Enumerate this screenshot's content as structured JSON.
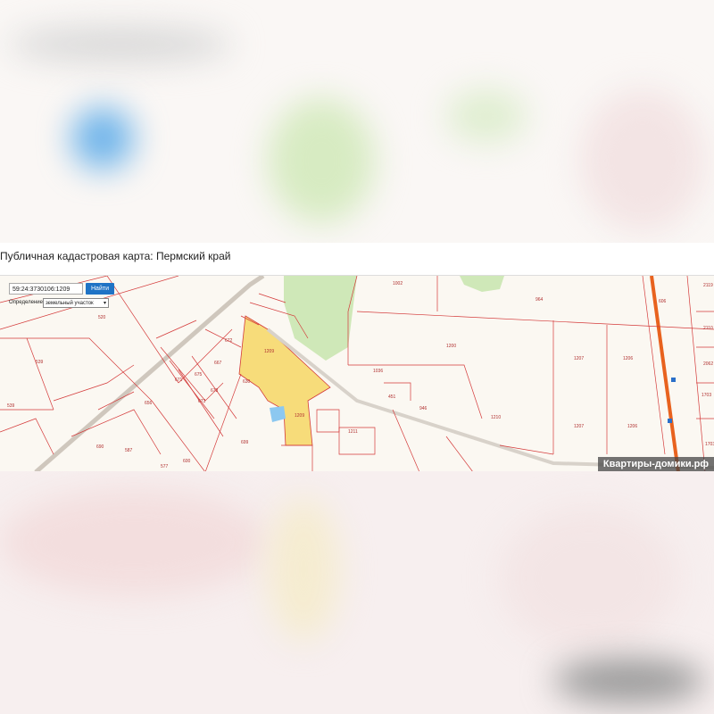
{
  "page_title": "Публичная кадастровая карта: Пермский край",
  "search": {
    "value": "59:24:3730106:1209",
    "button_label": "Найти"
  },
  "definition": {
    "label": "Определение",
    "selected": "земельный участок"
  },
  "watermark": "Квартиры-домики.рф",
  "plots": [
    "1002",
    "964",
    "2119",
    "520",
    "539",
    "539",
    "672",
    "667",
    "630",
    "671",
    "675",
    "673",
    "673",
    "690",
    "587",
    "600",
    "577",
    "656",
    "699",
    "1209",
    "1209",
    "1036",
    "1200",
    "451",
    "946",
    "1210",
    "1207",
    "1206",
    "1207",
    "1206",
    "1703",
    "1703",
    "1211",
    "2110",
    "2062",
    "606"
  ],
  "colors": {
    "boundary": "#d43a3a",
    "selected_plot": "#f7dc7a",
    "forest": "#cfe8b8",
    "water": "#8cc8f0",
    "road": "#e8621e"
  }
}
